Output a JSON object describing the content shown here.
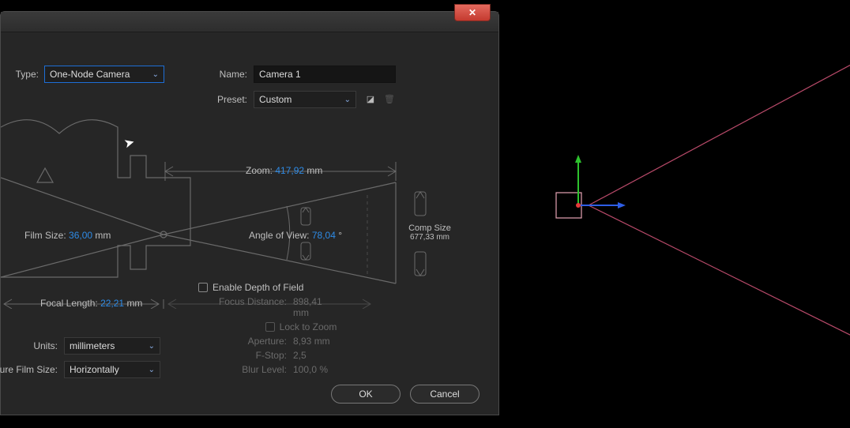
{
  "dialog": {
    "type_label": "Type:",
    "type_value": "One-Node Camera",
    "name_label": "Name:",
    "name_value": "Camera 1",
    "preset_label": "Preset:",
    "preset_value": "Custom"
  },
  "diagram": {
    "zoom_label": "Zoom:",
    "zoom_value": "417,92",
    "zoom_unit": "mm",
    "film_size_label": "Film Size:",
    "film_size_value": "36,00",
    "film_size_unit": "mm",
    "angle_label": "Angle of View:",
    "angle_value": "78,04",
    "angle_unit": "°",
    "comp_size_label": "Comp Size",
    "comp_size_value": "677,33 mm",
    "focal_label": "Focal Length:",
    "focal_value": "22,21",
    "focal_unit": "mm"
  },
  "dof": {
    "enable_label": "Enable Depth of Field",
    "focus_dist_label": "Focus Distance:",
    "focus_dist_value": "898,41 mm",
    "lock_label": "Lock to Zoom",
    "aperture_label": "Aperture:",
    "aperture_value": "8,93 mm",
    "fstop_label": "F-Stop:",
    "fstop_value": "2,5",
    "blur_label": "Blur Level:",
    "blur_value": "100,0 %"
  },
  "units": {
    "units_label": "Units:",
    "units_value": "millimeters",
    "measure_label": "asure Film Size:",
    "measure_value": "Horizontally"
  },
  "buttons": {
    "ok": "OK",
    "cancel": "Cancel"
  }
}
